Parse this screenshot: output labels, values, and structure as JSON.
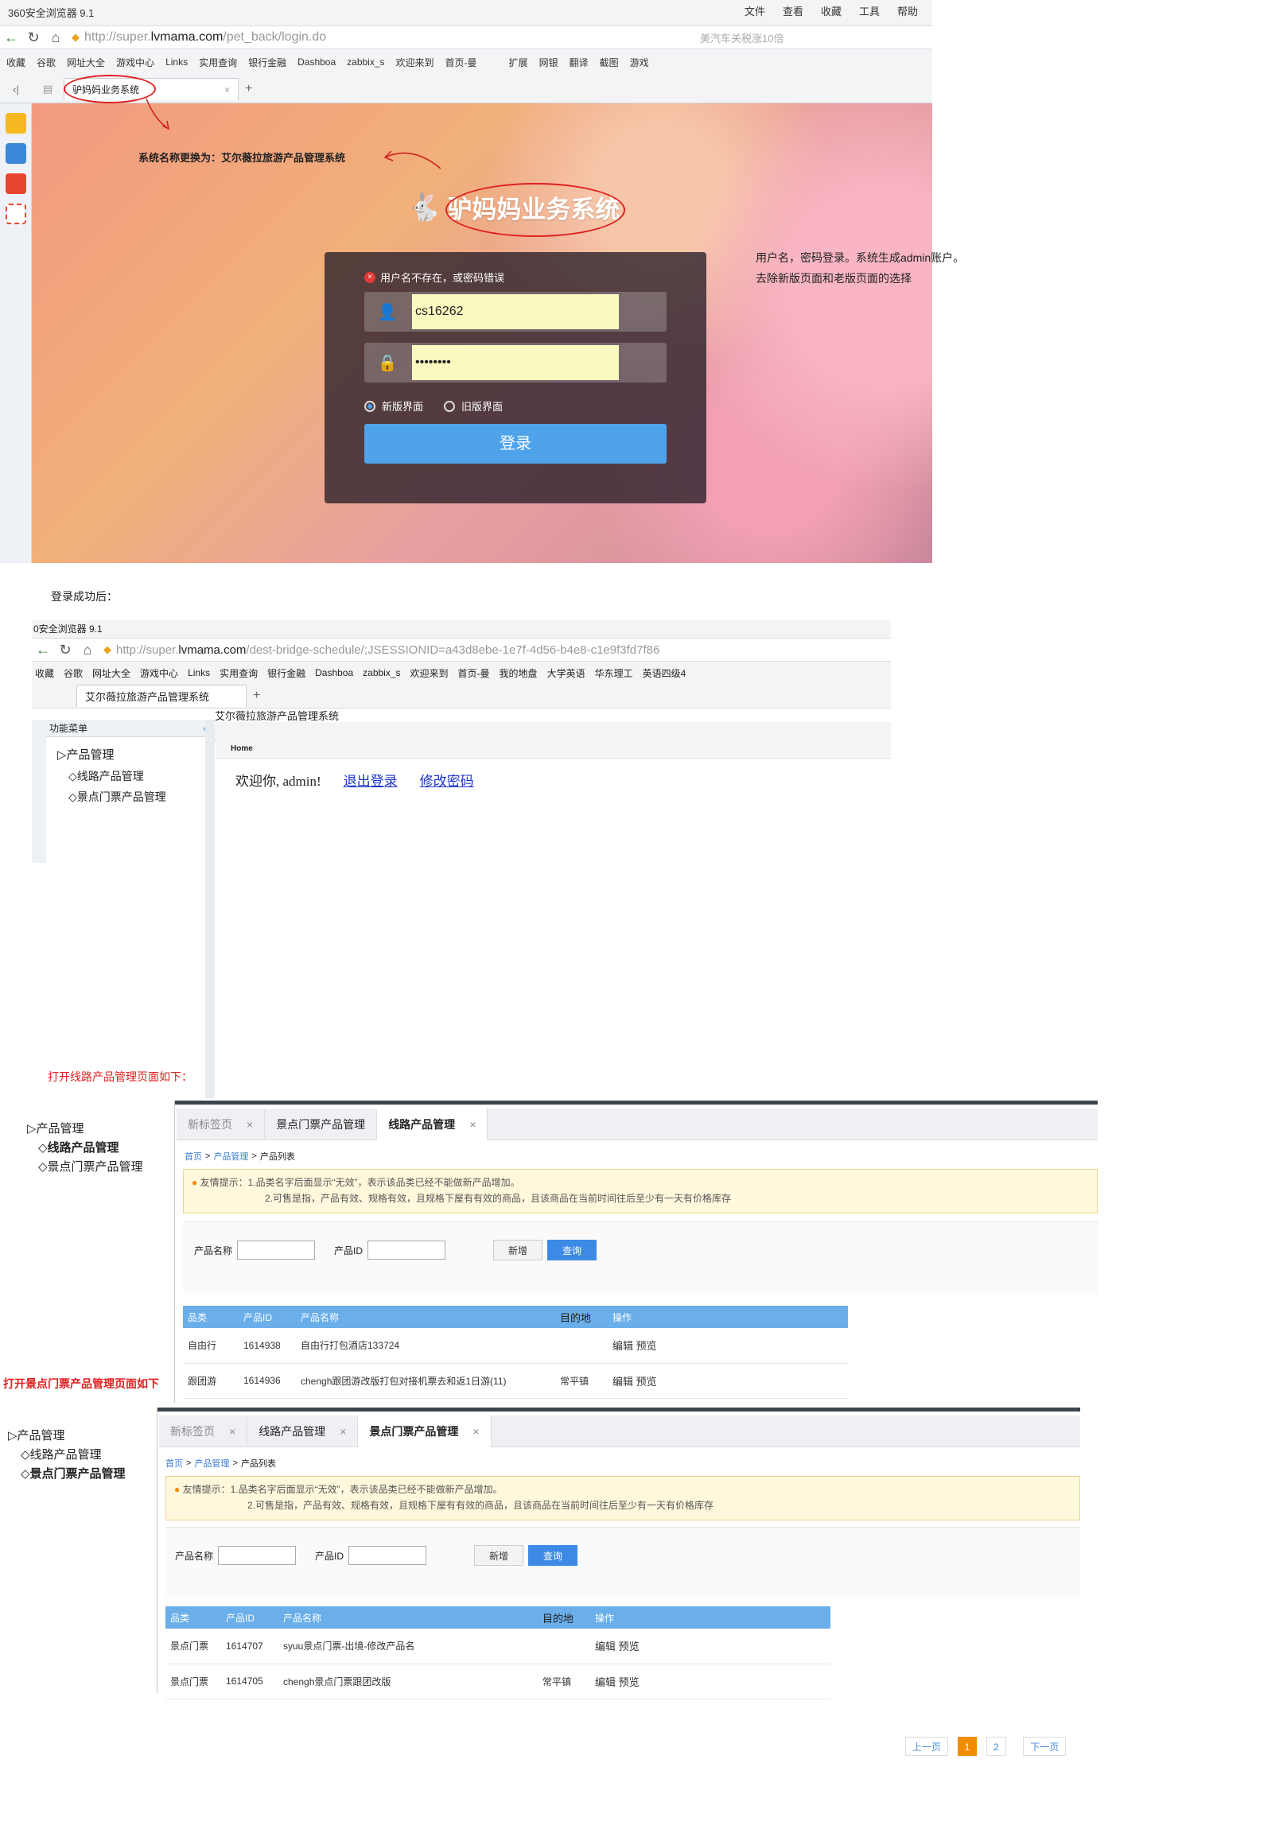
{
  "browser1": {
    "title": "360安全浏览器 9.1",
    "menu": [
      "文件",
      "查看",
      "收藏",
      "工具",
      "帮助"
    ],
    "url_prefix": "http://super.",
    "url_domain": "lvmama.com",
    "url_path": "/pet_back/login.do",
    "search_placeholder": "美汽车关税涨10倍",
    "bookmarks": [
      "收藏",
      "谷歌",
      "网址大全",
      "游戏中心",
      "Links",
      "实用查询",
      "银行金融",
      "Dashboa",
      "zabbix_s",
      "欢迎来到",
      "首页-曼",
      "扩展",
      "网银",
      "翻译",
      "截图",
      "游戏"
    ],
    "tab_title": "驴妈妈业务系统"
  },
  "login": {
    "logo_text": "驴妈妈业务系统",
    "error": "用户名不存在，或密码错误",
    "username": "cs16262",
    "password": "••••••••",
    "radio_new": "新版界面",
    "radio_old": "旧版界面",
    "submit": "登录"
  },
  "annotations": {
    "rename": "系统名称更换为：艾尔薇拉旅游产品管理系统",
    "note1": "用户名，密码登录。系统生成admin账户。",
    "note2": "去除新版页面和老版页面的选择",
    "after_login": "登录成功后：",
    "open_line": "打开线路产品管理页面如下：",
    "open_scenic": "打开景点门票产品管理页面如下"
  },
  "browser2": {
    "title": "0安全浏览器 9.1",
    "url_prefix": "http://super.",
    "url_domain": "lvmama.com",
    "url_path": "/dest-bridge-schedule/;JSESSIONID=a43d8ebe-1e7f-4d56-b4e8-c1e9f3fd7f86",
    "bookmarks": [
      "收藏",
      "谷歌",
      "网址大全",
      "游戏中心",
      "Links",
      "实用查询",
      "银行金融",
      "Dashboa",
      "zabbix_s",
      "欢迎来到",
      "首页-曼",
      "我的地盘",
      "大学英语",
      "华东理工",
      "英语四级4"
    ],
    "tab_title": "艾尔薇拉旅游产品管理系统"
  },
  "admin": {
    "menu_title": "功能菜单",
    "tree_root": "▷产品管理",
    "tree_items": [
      "◇线路产品管理",
      "◇景点门票产品管理"
    ],
    "page_title": "艾尔薇拉旅游产品管理系统",
    "home_tab": "Home",
    "welcome": "欢迎你, admin!",
    "logout": "退出登录",
    "change_pwd": "修改密码"
  },
  "common": {
    "breadcrumb": [
      "首页",
      "产品管理",
      "产品列表"
    ],
    "warn1": "友情提示：1.品类名字后面显示“无效”，表示该品类已经不能做新产品增加。",
    "warn2": "2.可售是指，产品有效、规格有效，且规格下屋有有效的商品，且该商品在当前时间往后至少有一天有价格库存",
    "name_label": "产品名称",
    "id_label": "产品ID",
    "add": "新增",
    "query": "查询",
    "headers": [
      "品类",
      "产品ID",
      "产品名称",
      "目的地",
      "操作"
    ],
    "edit": "编辑",
    "preview": "预览"
  },
  "line_page": {
    "tree_root": "▷产品管理",
    "tree_items": [
      "◇线路产品管理",
      "◇景点门票产品管理"
    ],
    "tabs": [
      "新标签页",
      "景点门票产品管理",
      "线路产品管理"
    ],
    "rows": [
      {
        "cat": "自由行",
        "id": "1614938",
        "name": "自由行打包酒店133724",
        "dest": ""
      },
      {
        "cat": "跟团游",
        "id": "1614936",
        "name": "chengh跟团游改版打包对接机票去和返1日游(11)",
        "dest": "常平镇"
      }
    ]
  },
  "scenic_page": {
    "tree_root": "▷产品管理",
    "tree_items": [
      "◇线路产品管理",
      "◇景点门票产品管理"
    ],
    "tabs": [
      "新标签页",
      "线路产品管理",
      "景点门票产品管理"
    ],
    "rows": [
      {
        "cat": "景点门票",
        "id": "1614707",
        "name": "syuu景点门票-出境-修改产品名",
        "dest": ""
      },
      {
        "cat": "景点门票",
        "id": "1614705",
        "name": "chengh景点门票跟团改版",
        "dest": "常平镇"
      }
    ],
    "pager": {
      "prev": "上一页",
      "pages": [
        "1",
        "2"
      ],
      "next": "下一页"
    }
  }
}
